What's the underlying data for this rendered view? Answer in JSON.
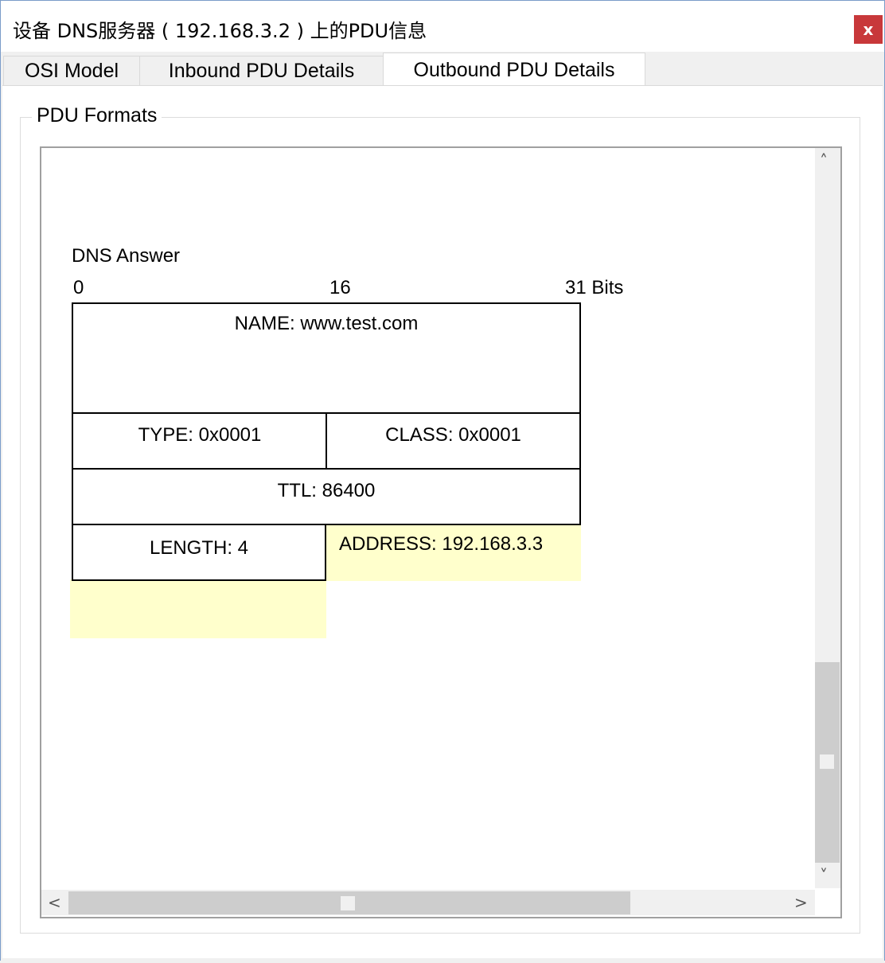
{
  "window": {
    "title": "设备 DNS服务器 ( 192.168.3.2 ) 上的PDU信息",
    "close_label": "x"
  },
  "tabs": [
    {
      "label": "OSI Model",
      "active": false
    },
    {
      "label": "Inbound PDU Details",
      "active": false
    },
    {
      "label": "Outbound PDU Details",
      "active": true
    }
  ],
  "group": {
    "label": "PDU Formats"
  },
  "pdu": {
    "title": "DNS Answer",
    "bit_scale": {
      "start": "0",
      "middle": "16",
      "end": "31 Bits"
    },
    "fields": {
      "name": "NAME: www.test.com",
      "type": "TYPE: 0x0001",
      "class": "CLASS: 0x0001",
      "ttl": "TTL: 86400",
      "length": "LENGTH: 4",
      "address": "ADDRESS: 192.168.3.3"
    },
    "highlight_color": "#ffffcc"
  },
  "scrollbars": {
    "up": "˄",
    "down": "˅",
    "left": "<",
    "right": ">"
  },
  "colors": {
    "close_button": "#c8383a",
    "border": "#7a9cc9"
  }
}
